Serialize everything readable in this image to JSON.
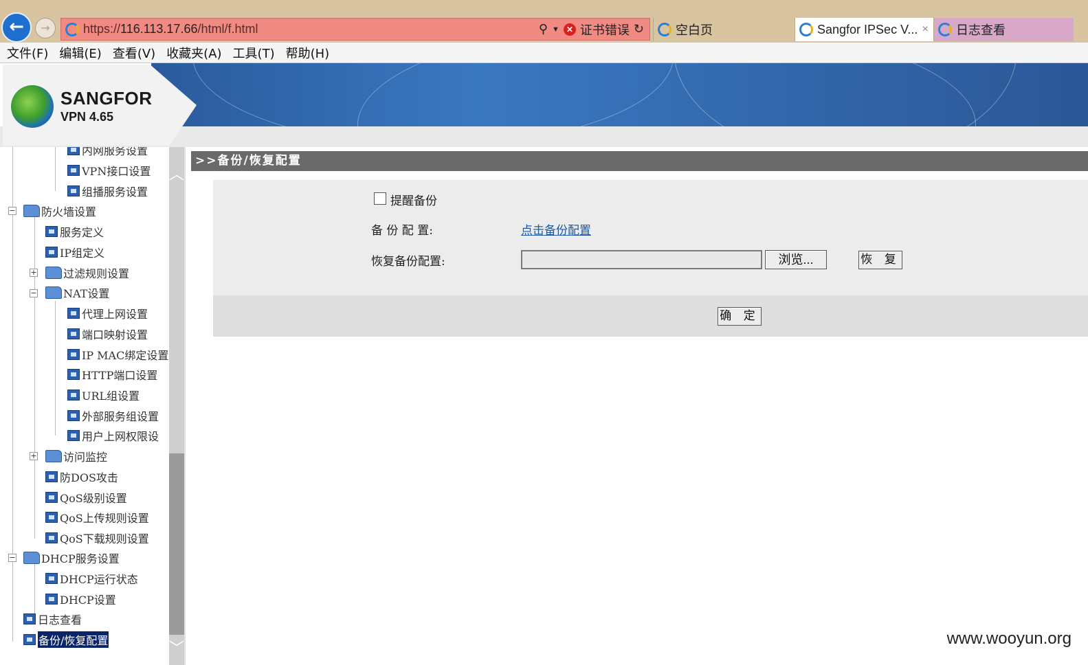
{
  "browser": {
    "url_scheme": "https://",
    "url_host": "116.113.17.66",
    "url_path": "/html/f.html",
    "cert_error": "证书错误",
    "tabs": [
      {
        "label": "空白页"
      },
      {
        "label": "Sangfor IPSec V..."
      },
      {
        "label": "日志查看"
      }
    ],
    "close_glyph": "×",
    "menu": [
      "文件(F)",
      "编辑(E)",
      "查看(V)",
      "收藏夹(A)",
      "工具(T)",
      "帮助(H)"
    ]
  },
  "brand": {
    "name": "SANGFOR",
    "version": "VPN 4.65"
  },
  "tree": {
    "items": [
      {
        "label": "内网服务设置"
      },
      {
        "label": "VPN接口设置"
      },
      {
        "label": "组播服务设置"
      },
      {
        "label": "防火墙设置"
      },
      {
        "label": "服务定义"
      },
      {
        "label": "IP组定义"
      },
      {
        "label": "过滤规则设置"
      },
      {
        "label": "NAT设置"
      },
      {
        "label": "代理上网设置"
      },
      {
        "label": "端口映射设置"
      },
      {
        "label": "IP MAC绑定设置"
      },
      {
        "label": "HTTP端口设置"
      },
      {
        "label": "URL组设置"
      },
      {
        "label": "外部服务组设置"
      },
      {
        "label": "用户上网权限设"
      },
      {
        "label": "访问监控"
      },
      {
        "label": "防DOS攻击"
      },
      {
        "label": "QoS级别设置"
      },
      {
        "label": "QoS上传规则设置"
      },
      {
        "label": "QoS下载规则设置"
      },
      {
        "label": "DHCP服务设置"
      },
      {
        "label": "DHCP运行状态"
      },
      {
        "label": "DHCP设置"
      },
      {
        "label": "日志查看"
      },
      {
        "label": "备份/恢复配置"
      }
    ]
  },
  "main": {
    "title": ">>备份/恢复配置",
    "remind_label": "提醒备份",
    "backup_label": "备 份 配 置:",
    "backup_link": "点击备份配置",
    "restore_label": "恢复备份配置:",
    "browse_button": "浏览...",
    "restore_button": "恢 复",
    "confirm_button": "确 定"
  },
  "watermark": "www.wooyun.org"
}
